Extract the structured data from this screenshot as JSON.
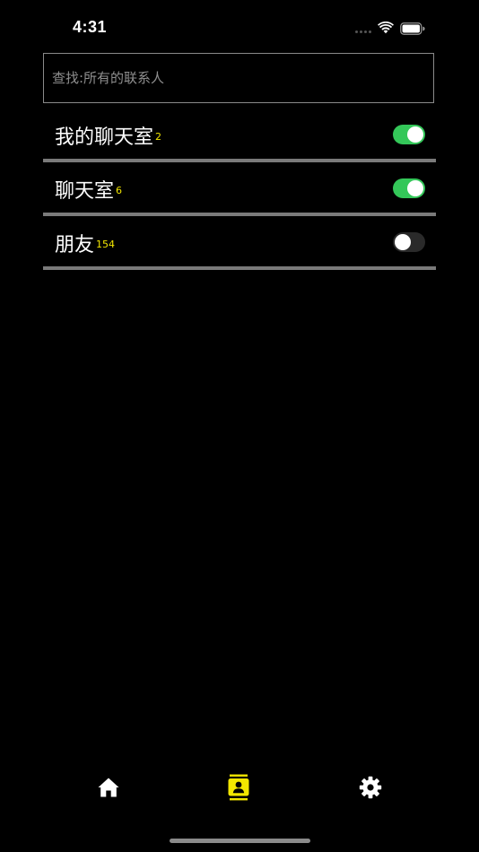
{
  "status_bar": {
    "time": "4:31"
  },
  "search": {
    "placeholder": "查找:所有的联系人",
    "value": ""
  },
  "list": [
    {
      "label": "我的聊天室",
      "count": "2",
      "toggle_on": true
    },
    {
      "label": "聊天室",
      "count": "6",
      "toggle_on": true
    },
    {
      "label": "朋友",
      "count": "154",
      "toggle_on": false
    }
  ],
  "tab_bar": {
    "items": [
      {
        "icon": "home-icon",
        "active": false
      },
      {
        "icon": "contacts-icon",
        "active": true
      },
      {
        "icon": "gear-icon",
        "active": false
      }
    ]
  },
  "colors": {
    "background": "#000000",
    "accent": "#f2e600",
    "toggle_on": "#34c759",
    "divider": "#7a7a7a"
  }
}
